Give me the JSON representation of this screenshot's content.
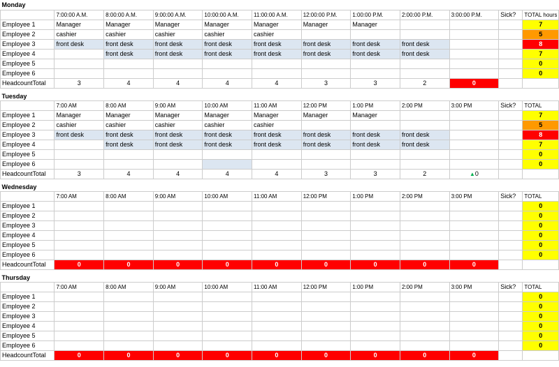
{
  "days": [
    {
      "name": "Monday",
      "times": [
        "7:00:00 A.M.",
        "8:00:00 A.M.",
        "9:00:00 A.M.",
        "10:00:00 A.M.",
        "11:00:00 A.M.",
        "12:00:00 P.M.",
        "1:00:00 P.M.",
        "2:00:00 P.M.",
        "3:00:00 P.M."
      ],
      "sick_label": "Sick?",
      "total_label": "TOTAL hours worked",
      "employees": [
        {
          "name": "Employee 1",
          "shifts": [
            "Manager",
            "Manager",
            "Manager",
            "Manager",
            "Manager",
            "Manager",
            "Manager",
            "",
            ""
          ],
          "sick": "",
          "total": "7",
          "total_bg": "yellow"
        },
        {
          "name": "Employee 2",
          "shifts": [
            "cashier",
            "cashier",
            "cashier",
            "cashier",
            "cashier",
            "",
            "",
            "",
            ""
          ],
          "sick": "",
          "total": "5",
          "total_bg": "orange"
        },
        {
          "name": "Employee 3",
          "shifts": [
            "front desk",
            "front desk",
            "front desk",
            "front desk",
            "front desk",
            "front desk",
            "front desk",
            "front desk",
            ""
          ],
          "sick": "",
          "total": "8",
          "total_bg": "red"
        },
        {
          "name": "Employee 4",
          "shifts": [
            "",
            "front desk",
            "front desk",
            "front desk",
            "front desk",
            "front desk",
            "front desk",
            "front desk",
            ""
          ],
          "sick": "",
          "total": "7",
          "total_bg": "yellow"
        },
        {
          "name": "Employee 5",
          "shifts": [
            "",
            "",
            "",
            "",
            "",
            "",
            "",
            "",
            ""
          ],
          "sick": "",
          "total": "0",
          "total_bg": "yellow"
        },
        {
          "name": "Employee 6",
          "shifts": [
            "",
            "",
            "",
            "",
            "",
            "",
            "",
            "",
            ""
          ],
          "sick": "",
          "total": "0",
          "total_bg": "yellow"
        }
      ],
      "headcount": [
        "3",
        "4",
        "4",
        "4",
        "4",
        "3",
        "3",
        "2",
        "0"
      ],
      "headcount_last_bg": "red"
    },
    {
      "name": "Tuesday",
      "times": [
        "7:00 AM",
        "8:00 AM",
        "9:00 AM",
        "10:00 AM",
        "11:00 AM",
        "12:00 PM",
        "1:00 PM",
        "2:00 PM",
        "3:00 PM"
      ],
      "sick_label": "Sick?",
      "total_label": "TOTAL",
      "employees": [
        {
          "name": "Employee 1",
          "shifts": [
            "Manager",
            "Manager",
            "Manager",
            "Manager",
            "Manager",
            "Manager",
            "Manager",
            "",
            ""
          ],
          "sick": "",
          "total": "7",
          "total_bg": "yellow"
        },
        {
          "name": "Employee 2",
          "shifts": [
            "cashier",
            "cashier",
            "cashier",
            "cashier",
            "cashier",
            "",
            "",
            "",
            ""
          ],
          "sick": "",
          "total": "5",
          "total_bg": "orange"
        },
        {
          "name": "Employee 3",
          "shifts": [
            "front desk",
            "front desk",
            "front desk",
            "front desk",
            "front desk",
            "front desk",
            "front desk",
            "front desk",
            ""
          ],
          "sick": "",
          "total": "8",
          "total_bg": "red"
        },
        {
          "name": "Employee 4",
          "shifts": [
            "",
            "front desk",
            "front desk",
            "front desk",
            "front desk",
            "front desk",
            "front desk",
            "front desk",
            ""
          ],
          "sick": "",
          "total": "7",
          "total_bg": "yellow"
        },
        {
          "name": "Employee 5",
          "shifts": [
            "",
            "",
            "",
            "",
            "",
            "",
            "",
            "",
            ""
          ],
          "sick": "",
          "total": "0",
          "total_bg": "yellow"
        },
        {
          "name": "Employee 6",
          "shifts": [
            "",
            "",
            "",
            "light blue",
            "",
            "",
            "",
            "",
            ""
          ],
          "sick": "",
          "total": "0",
          "total_bg": "yellow"
        }
      ],
      "headcount": [
        "3",
        "4",
        "4",
        "4",
        "4",
        "3",
        "3",
        "2",
        "0"
      ],
      "headcount_last_bg": "normal"
    },
    {
      "name": "Wednesday",
      "times": [
        "7:00 AM",
        "8:00 AM",
        "9:00 AM",
        "10:00 AM",
        "11:00 AM",
        "12:00 PM",
        "1:00 PM",
        "2:00 PM",
        "3:00 PM"
      ],
      "sick_label": "Sick?",
      "total_label": "TOTAL",
      "employees": [
        {
          "name": "Employee 1",
          "shifts": [
            "",
            "",
            "",
            "",
            "",
            "",
            "",
            "",
            ""
          ],
          "sick": "",
          "total": "0",
          "total_bg": "yellow"
        },
        {
          "name": "Employee 2",
          "shifts": [
            "",
            "",
            "",
            "",
            "",
            "",
            "",
            "",
            ""
          ],
          "sick": "",
          "total": "0",
          "total_bg": "yellow"
        },
        {
          "name": "Employee 3",
          "shifts": [
            "",
            "",
            "",
            "",
            "",
            "",
            "",
            "",
            ""
          ],
          "sick": "",
          "total": "0",
          "total_bg": "yellow"
        },
        {
          "name": "Employee 4",
          "shifts": [
            "",
            "",
            "",
            "",
            "",
            "",
            "",
            "",
            ""
          ],
          "sick": "",
          "total": "0",
          "total_bg": "yellow"
        },
        {
          "name": "Employee 5",
          "shifts": [
            "",
            "",
            "",
            "",
            "",
            "",
            "",
            "",
            ""
          ],
          "sick": "",
          "total": "0",
          "total_bg": "yellow"
        },
        {
          "name": "Employee 6",
          "shifts": [
            "",
            "",
            "",
            "",
            "",
            "",
            "",
            "",
            ""
          ],
          "sick": "",
          "total": "0",
          "total_bg": "yellow"
        }
      ],
      "headcount": [
        "0",
        "0",
        "0",
        "0",
        "0",
        "0",
        "0",
        "0",
        "0"
      ],
      "headcount_last_bg": "red"
    },
    {
      "name": "Thursday",
      "times": [
        "7:00 AM",
        "8:00 AM",
        "9:00 AM",
        "10:00 AM",
        "11:00 AM",
        "12:00 PM",
        "1:00 PM",
        "2:00 PM",
        "3:00 PM"
      ],
      "sick_label": "Sick?",
      "total_label": "TOTAL",
      "employees": [
        {
          "name": "Employee 1",
          "shifts": [
            "",
            "",
            "",
            "",
            "",
            "",
            "",
            "",
            ""
          ],
          "sick": "",
          "total": "0",
          "total_bg": "yellow"
        },
        {
          "name": "Employee 2",
          "shifts": [
            "",
            "",
            "",
            "",
            "",
            "",
            "",
            "",
            ""
          ],
          "sick": "",
          "total": "0",
          "total_bg": "yellow"
        },
        {
          "name": "Employee 3",
          "shifts": [
            "",
            "",
            "",
            "",
            "",
            "",
            "",
            "",
            ""
          ],
          "sick": "",
          "total": "0",
          "total_bg": "yellow"
        },
        {
          "name": "Employee 4",
          "shifts": [
            "",
            "",
            "",
            "",
            "",
            "",
            "",
            "",
            ""
          ],
          "sick": "",
          "total": "0",
          "total_bg": "yellow"
        },
        {
          "name": "Employee 5",
          "shifts": [
            "",
            "",
            "",
            "",
            "",
            "",
            "",
            "",
            ""
          ],
          "sick": "",
          "total": "0",
          "total_bg": "yellow"
        },
        {
          "name": "Employee 6",
          "shifts": [
            "",
            "",
            "",
            "",
            "",
            "",
            "",
            "",
            ""
          ],
          "sick": "",
          "total": "0",
          "total_bg": "yellow"
        }
      ],
      "headcount": [
        "0",
        "0",
        "0",
        "0",
        "0",
        "0",
        "0",
        "0",
        "0"
      ],
      "headcount_last_bg": "red"
    }
  ]
}
